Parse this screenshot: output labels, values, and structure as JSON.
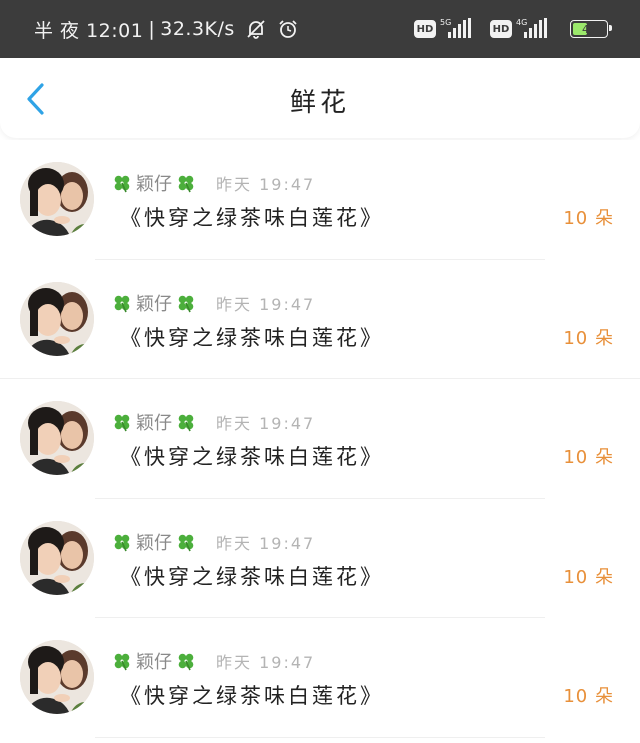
{
  "status_bar": {
    "time": "半 夜 12:01",
    "speed": "32.3K/s",
    "net1_gen": "5G",
    "net2_gen": "4G",
    "hd_label": "HD",
    "battery_level": "48",
    "battery_fraction": 0.48,
    "battery_color": "#9be86b"
  },
  "header": {
    "title": "鲜花",
    "back_icon": "chevron-left-icon",
    "accent": "#2fa3e6"
  },
  "items": [
    {
      "name": "颖仔",
      "time": "昨天 19:47",
      "book": "《快穿之绿茶味白莲花》",
      "amount": "10 朵"
    },
    {
      "name": "颖仔",
      "time": "昨天 19:47",
      "book": "《快穿之绿茶味白莲花》",
      "amount": "10 朵"
    },
    {
      "name": "颖仔",
      "time": "昨天 19:47",
      "book": "《快穿之绿茶味白莲花》",
      "amount": "10 朵"
    },
    {
      "name": "颖仔",
      "time": "昨天 19:47",
      "book": "《快穿之绿茶味白莲花》",
      "amount": "10 朵"
    },
    {
      "name": "颖仔",
      "time": "昨天 19:47",
      "book": "《快穿之绿茶味白莲花》",
      "amount": "10 朵"
    }
  ],
  "colors": {
    "amount": "#e8903a",
    "clover": "#4caf3c"
  }
}
